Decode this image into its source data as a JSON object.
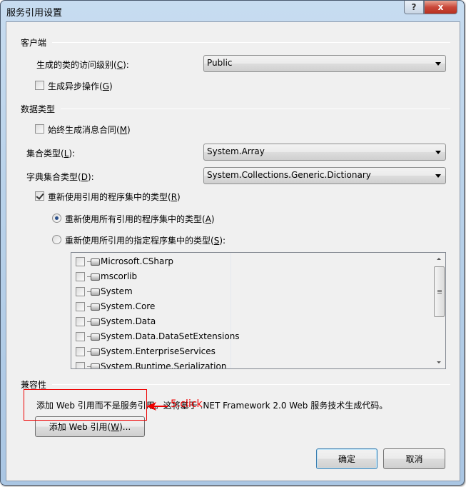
{
  "window": {
    "title": "服务引用设置",
    "help_label": "?",
    "close_label": "x"
  },
  "client": {
    "section_label": "客户端",
    "access_label": {
      "pre": "生成的类的访问级别(",
      "key": "C",
      "post": "):"
    },
    "access_value": "Public",
    "async": {
      "pre": "生成异步操作(",
      "key": "G",
      "post": ")",
      "checked": false
    }
  },
  "datatype": {
    "section_label": "数据类型",
    "always_msg": {
      "pre": "始终生成消息合同(",
      "key": "M",
      "post": ")",
      "checked": false
    },
    "collection_label": {
      "pre": "集合类型(",
      "key": "L",
      "post": "):"
    },
    "collection_value": "System.Array",
    "dict_label": {
      "pre": "字典集合类型(",
      "key": "D",
      "post": "):"
    },
    "dict_value": "System.Collections.Generic.Dictionary",
    "reuse": {
      "pre": "重新使用引用的程序集中的类型(",
      "key": "R",
      "post": ")",
      "checked": true
    },
    "reuse_all": {
      "pre": "重新使用所有引用的程序集中的类型(",
      "key": "A",
      "post": ")",
      "selected": true
    },
    "reuse_specified": {
      "pre": "重新使用所引用的指定程序集中的类型(",
      "key": "S",
      "post": "):",
      "selected": false
    },
    "assemblies": [
      {
        "name": "Microsoft.CSharp",
        "checked": false
      },
      {
        "name": "mscorlib",
        "checked": false
      },
      {
        "name": "System",
        "checked": false
      },
      {
        "name": "System.Core",
        "checked": false
      },
      {
        "name": "System.Data",
        "checked": false
      },
      {
        "name": "System.Data.DataSetExtensions",
        "checked": false
      },
      {
        "name": "System.EnterpriseServices",
        "checked": false
      },
      {
        "name": "System.Runtime.Serialization",
        "checked": false
      }
    ]
  },
  "compat": {
    "section_label": "兼容性",
    "description": "添加 Web 引用而不是服务引用。这将基于 .NET Framework 2.0 Web 服务技术生成代码。",
    "add_web_ref": {
      "pre": "添加 Web 引用(",
      "key": "W",
      "post": ")..."
    }
  },
  "annotation": {
    "text": "5.click",
    "color": "#e00000"
  },
  "footer": {
    "ok_label": "确定",
    "cancel_label": "取消"
  }
}
